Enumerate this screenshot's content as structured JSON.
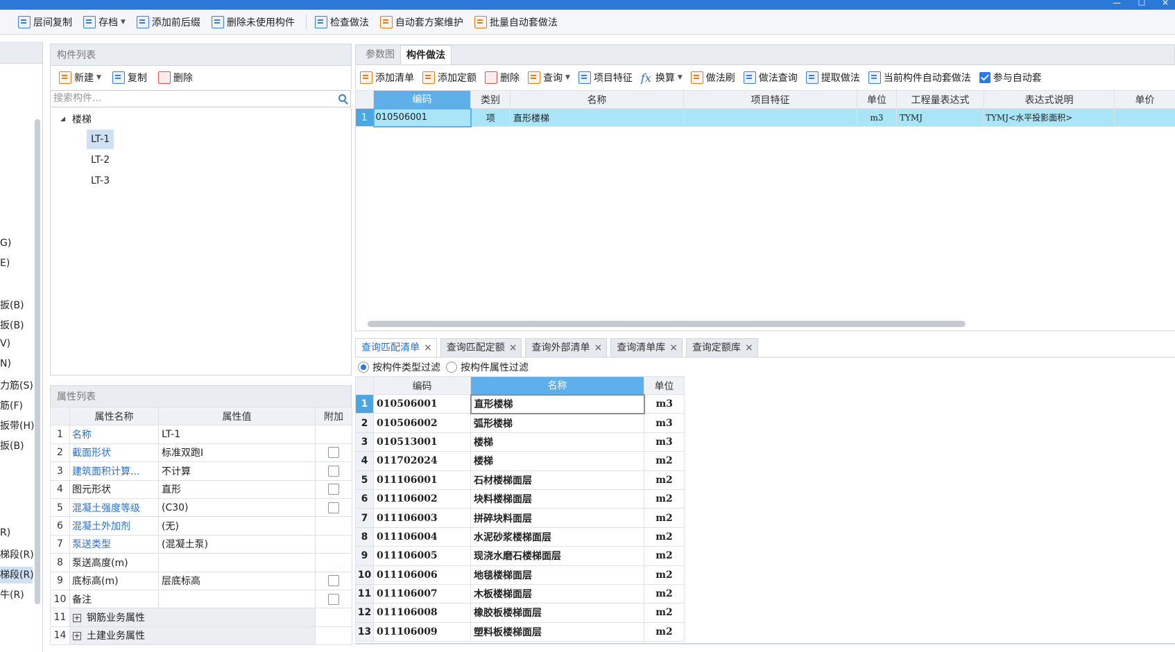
{
  "window": {
    "minimize": "—",
    "maximize": "☐",
    "close": "✕"
  },
  "toolbar": {
    "items": [
      {
        "label": "层间复制",
        "icon": "copy-floor-icon"
      },
      {
        "label": "存档",
        "icon": "archive-icon",
        "dropdown": true
      },
      {
        "label": "添加前后缀",
        "icon": "add-prefix-icon"
      },
      {
        "label": "删除未使用构件",
        "icon": "delete-unused-icon"
      },
      {
        "label": "检查做法",
        "icon": "check-method-icon"
      },
      {
        "label": "自动套方案维护",
        "icon": "auto-scheme-icon"
      },
      {
        "label": "批量自动套做法",
        "icon": "batch-auto-icon"
      }
    ]
  },
  "left_strip": {
    "items": [
      "G)",
      "E)",
      "扳(B)",
      "扳(B)",
      "V)",
      "N)",
      "力筋(S)",
      "筋(F)",
      "扳带(H)",
      "扳(B)",
      "R)",
      "梯段(R)",
      "梯段(R)",
      "牛(R)"
    ],
    "selected_index": 10
  },
  "component_list": {
    "header": "构件列表",
    "new_label": "新建",
    "copy_label": "复制",
    "delete_label": "删除",
    "search_placeholder": "搜索构件...",
    "tree_root": "楼梯",
    "items": [
      "LT-1",
      "LT-2",
      "LT-3"
    ],
    "selected": "LT-1"
  },
  "property_list": {
    "header": "属性列表",
    "columns": [
      "属性名称",
      "属性值",
      "附加"
    ],
    "rows": [
      {
        "idx": "1",
        "name": "名称",
        "value": "LT-1",
        "blue": true,
        "check": false
      },
      {
        "idx": "2",
        "name": "截面形状",
        "value": "标准双跑I",
        "blue": true,
        "check": true
      },
      {
        "idx": "3",
        "name": "建筑面积计算...",
        "value": "不计算",
        "blue": true,
        "check": true
      },
      {
        "idx": "4",
        "name": "图元形状",
        "value": "直形",
        "blue": false,
        "check": true
      },
      {
        "idx": "5",
        "name": "混凝土强度等级",
        "value": "(C30)",
        "blue": true,
        "check": true
      },
      {
        "idx": "6",
        "name": "混凝土外加剂",
        "value": "(无)",
        "blue": true,
        "check": false
      },
      {
        "idx": "7",
        "name": "泵送类型",
        "value": "(混凝土泵)",
        "blue": true,
        "check": false
      },
      {
        "idx": "8",
        "name": "泵送高度(m)",
        "value": "",
        "blue": false,
        "check": false
      },
      {
        "idx": "9",
        "name": "底标高(m)",
        "value": "层底标高",
        "blue": false,
        "check": true
      },
      {
        "idx": "10",
        "name": "备注",
        "value": "",
        "blue": false,
        "check": true
      }
    ],
    "groups": [
      {
        "idx": "11",
        "name": "钢筋业务属性"
      },
      {
        "idx": "14",
        "name": "土建业务属性"
      }
    ]
  },
  "right_tabs": {
    "items": [
      "参数图",
      "构件做法"
    ],
    "active": 1
  },
  "method_toolbar": {
    "add_list": "添加清单",
    "add_quota": "添加定额",
    "delete": "删除",
    "query": "查询",
    "feature": "项目特征",
    "fx": "fx",
    "convert": "换算",
    "brush": "做法刷",
    "method_query": "做法查询",
    "extract": "提取做法",
    "current_auto": "当前构件自动套做法",
    "participate": "参与自动套"
  },
  "method_grid": {
    "columns": [
      "编码",
      "类别",
      "名称",
      "项目特征",
      "单位",
      "工程量表达式",
      "表达式说明",
      "单价"
    ],
    "rows": [
      {
        "rn": "1",
        "code": "010506001",
        "type": "项",
        "name": "直形楼梯",
        "feature": "",
        "unit": "m3",
        "expr": "TYMJ",
        "desc": "TYMJ<水平投影面积>",
        "price": ""
      }
    ]
  },
  "query_tabs": {
    "items": [
      "查询匹配清单",
      "查询匹配定额",
      "查询外部清单",
      "查询清单库",
      "查询定额库"
    ],
    "active": 0,
    "close": "×"
  },
  "filters": {
    "type_filter": "按构件类型过滤",
    "attr_filter": "按构件属性过滤",
    "selected": "type_filter"
  },
  "match_grid": {
    "columns": [
      "编码",
      "名称",
      "单位"
    ],
    "rows": [
      {
        "rn": "1",
        "code": "010506001",
        "name": "直形楼梯",
        "unit": "m3"
      },
      {
        "rn": "2",
        "code": "010506002",
        "name": "弧形楼梯",
        "unit": "m3"
      },
      {
        "rn": "3",
        "code": "010513001",
        "name": "楼梯",
        "unit": "m3"
      },
      {
        "rn": "4",
        "code": "011702024",
        "name": "楼梯",
        "unit": "m2"
      },
      {
        "rn": "5",
        "code": "011106001",
        "name": "石材楼梯面层",
        "unit": "m2"
      },
      {
        "rn": "6",
        "code": "011106002",
        "name": "块料楼梯面层",
        "unit": "m2"
      },
      {
        "rn": "7",
        "code": "011106003",
        "name": "拼碎块料面层",
        "unit": "m2"
      },
      {
        "rn": "8",
        "code": "011106004",
        "name": "水泥砂浆楼梯面层",
        "unit": "m2"
      },
      {
        "rn": "9",
        "code": "011106005",
        "name": "现浇水磨石楼梯面层",
        "unit": "m2"
      },
      {
        "rn": "10",
        "code": "011106006",
        "name": "地毯楼梯面层",
        "unit": "m2"
      },
      {
        "rn": "11",
        "code": "011106007",
        "name": "木板楼梯面层",
        "unit": "m2"
      },
      {
        "rn": "12",
        "code": "011106008",
        "name": "橡胶板楼梯面层",
        "unit": "m2"
      },
      {
        "rn": "13",
        "code": "011106009",
        "name": "塑料板楼梯面层",
        "unit": "m2"
      }
    ]
  }
}
